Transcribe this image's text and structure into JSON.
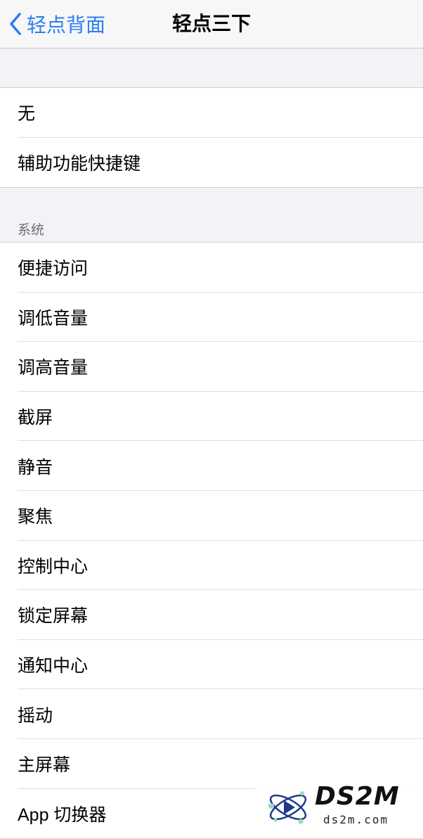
{
  "colors": {
    "accent": "#2f7cf6",
    "background": "#f2f2f7",
    "separator": "#d1d1d6",
    "section_header_text": "#6d6d72"
  },
  "navbar": {
    "back_icon": "chevron-left-icon",
    "back_label": "轻点背面",
    "title": "轻点三下"
  },
  "group1": {
    "items": [
      {
        "label": "无"
      },
      {
        "label": "辅助功能快捷键"
      }
    ]
  },
  "system_section": {
    "header": "系统",
    "items": [
      {
        "label": "便捷访问"
      },
      {
        "label": "调低音量"
      },
      {
        "label": "调高音量"
      },
      {
        "label": "截屏"
      },
      {
        "label": "静音"
      },
      {
        "label": "聚焦"
      },
      {
        "label": "控制中心"
      },
      {
        "label": "锁定屏幕"
      },
      {
        "label": "通知中心"
      },
      {
        "label": "摇动"
      },
      {
        "label": "主屏幕"
      },
      {
        "label": "App 切换器"
      }
    ]
  },
  "watermark": {
    "brand": "DS2M",
    "site": "ds2m.com",
    "icon": "atom-logo-icon"
  }
}
